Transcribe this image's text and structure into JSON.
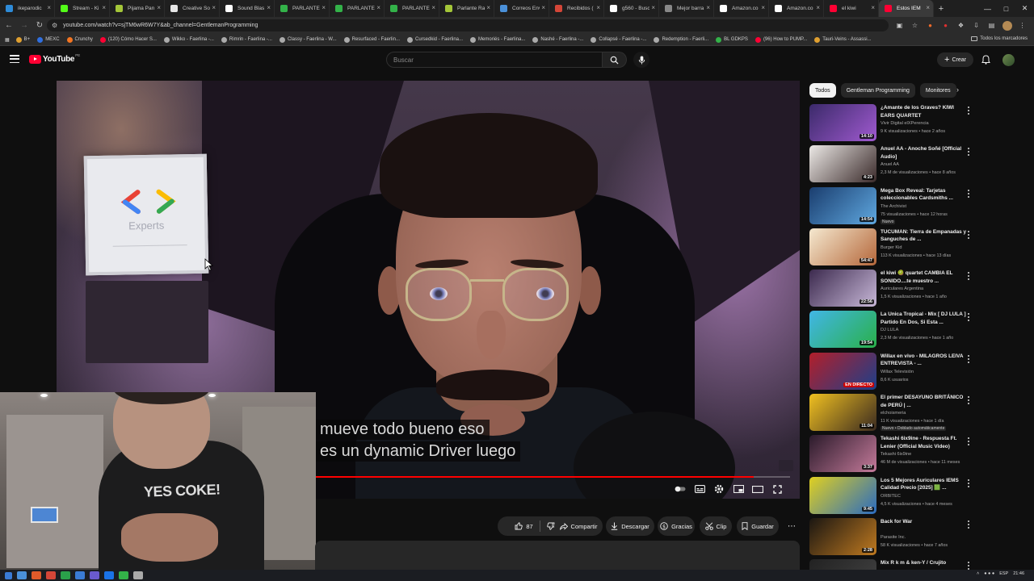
{
  "browser": {
    "tabs": [
      {
        "title": "ikeparodic",
        "favicon_color": "#2e8bd8"
      },
      {
        "title": "Stream - Ki",
        "favicon_color": "#53fc18"
      },
      {
        "title": "Pijama Pan",
        "favicon_color": "#a4c639"
      },
      {
        "title": "Creative So",
        "favicon_color": "#e6e6e6"
      },
      {
        "title": "Sound Blas",
        "favicon_color": "#ffffff"
      },
      {
        "title": "PARLANTE",
        "favicon_color": "#33b249"
      },
      {
        "title": "PARLANTE",
        "favicon_color": "#33b249"
      },
      {
        "title": "PARLANTE",
        "favicon_color": "#33b249"
      },
      {
        "title": "Parlante Ra",
        "favicon_color": "#a4c639"
      },
      {
        "title": "Correos Env",
        "favicon_color": "#4a90d9"
      },
      {
        "title": "Recibidos (",
        "favicon_color": "#d44638"
      },
      {
        "title": "g560 - Busc",
        "favicon_color": "#ffffff"
      },
      {
        "title": "Mejor barra",
        "favicon_color": "#888888"
      },
      {
        "title": "Amazon.co",
        "favicon_color": "#ffffff"
      },
      {
        "title": "Amazon.co",
        "favicon_color": "#ffffff"
      },
      {
        "title": "el kiwi",
        "favicon_color": "#ff0033"
      },
      {
        "title": "Estos IEM",
        "favicon_color": "#ff0033",
        "active": true
      }
    ],
    "url": "youtube.com/watch?v=sjTM6wR6W7Y&ab_channel=GentlemanProgramming",
    "bookmarks": [
      {
        "label": "B+",
        "color": "#e0a030"
      },
      {
        "label": "MEXC",
        "color": "#2f6fe0"
      },
      {
        "label": "Crunchy",
        "color": "#f47521"
      },
      {
        "label": "(120) Cómo Hacer S...",
        "color": "#ff0033"
      },
      {
        "label": "Wikko - Faerlina -...",
        "color": "#aaaaaa"
      },
      {
        "label": "Rimrin - Faerlina -...",
        "color": "#aaaaaa"
      },
      {
        "label": "Classy - Faerlina - W...",
        "color": "#aaaaaa"
      },
      {
        "label": "Resurfaced - Faerlin...",
        "color": "#aaaaaa"
      },
      {
        "label": "Cursedkid - Faerlina...",
        "color": "#aaaaaa"
      },
      {
        "label": "Memoriés - Faerlina...",
        "color": "#aaaaaa"
      },
      {
        "label": "Nashé - Faerlina -...",
        "color": "#aaaaaa"
      },
      {
        "label": "Collapsé - Faerlina -...",
        "color": "#aaaaaa"
      },
      {
        "label": "Redemption - Faerli...",
        "color": "#aaaaaa"
      },
      {
        "label": "BL GDKPS",
        "color": "#33b249"
      },
      {
        "label": "(96) How to PUMP...",
        "color": "#ff0033"
      },
      {
        "label": "Tauri-Veins - Assassi...",
        "color": "#e0a030"
      }
    ],
    "all_bookmarks": "Todos los marcadores"
  },
  "youtube": {
    "logo_text": "YouTube",
    "logo_region": "PE",
    "search_placeholder": "Buscar",
    "create_label": "Crear"
  },
  "player": {
    "caption_lines": [
      "mueve todo bueno eso",
      "es un dynamic Driver luego"
    ],
    "progress_fraction": 0.95,
    "sign_text": "Experts",
    "webcam_shirt_text": "YES COKE!"
  },
  "actions": {
    "like_count": "87",
    "share": "Compartir",
    "download": "Descargar",
    "thanks": "Gracias",
    "clip": "Clip",
    "save": "Guardar"
  },
  "chips": [
    "Todos",
    "Gentleman Programming",
    "Monitores"
  ],
  "recommendations": [
    {
      "title": "¿Amante de los Graves? KIWI EARS QUARTET",
      "channel": "Vivir Digital elXPerencia",
      "meta": "9 K visualizaciones • hace 2 años",
      "duration": "14:10",
      "thumb": [
        "#3b2a6a",
        "#a05ad0"
      ],
      "badge": ""
    },
    {
      "title": "Anuel AA - Anoche Soñé [Official Audio]",
      "channel": "Anuel AA",
      "meta": "2,3 M de visualizaciones • hace 8 años",
      "duration": "4:23",
      "thumb": [
        "#ece9e6",
        "#3a2a2a"
      ],
      "badge": ""
    },
    {
      "title": "Mega Box Reveal: Tarjetas coleccionables Cardsmiths ...",
      "channel": "The Archivist",
      "meta": "75 visualizaciones • hace 12 horas",
      "duration": "14:54",
      "thumb": [
        "#1a3d6e",
        "#5fa8e0"
      ],
      "badge": "Nuevo"
    },
    {
      "title": "TUCUMAN: Tierra de Empanadas y Sanguches de ...",
      "channel": "Burger Kid",
      "meta": "113 K visualizaciones • hace 13 días",
      "duration": "54:47",
      "thumb": [
        "#f5e9d0",
        "#b5673a"
      ],
      "badge": ""
    },
    {
      "title": "el kiwi 🥝 quartet CAMBIA EL SONIDO....te muestro ...",
      "channel": "Auriculares Argentina",
      "meta": "1,5 K visualizaciones • hace 1 año",
      "duration": "22:56",
      "thumb": [
        "#3c2a4e",
        "#c8b8d8"
      ],
      "badge": ""
    },
    {
      "title": "La Unica Tropical - Mix [ DJ LULA ] Partido En Dos, Si Esta ...",
      "channel": "DJ LULA",
      "meta": "2,3 M de visualizaciones • hace 1 año",
      "duration": "19:54",
      "thumb": [
        "#41b6e6",
        "#2ab04a"
      ],
      "badge": ""
    },
    {
      "title": "Willax en vivo - MILAGROS LEIVA ENTREVISTA - ...",
      "channel": "Willax Televisión",
      "meta": "8,6 K usuarios",
      "duration": "EN DIRECTO",
      "thumb": [
        "#b21f2a",
        "#1d3f8a"
      ],
      "badge": ""
    },
    {
      "title": "El primer DESAYUNO BRITÁNICO de PERÚ | ...",
      "channel": "elchoismeria",
      "meta": "11 K visualizaciones • hace 1 día",
      "duration": "11:04",
      "thumb": [
        "#f0c020",
        "#3a2a20"
      ],
      "badge": "Nuevo • Doblado automáticamente"
    },
    {
      "title": "Tekashi 6ix9ine - Respuesta Ft. Lenier (Official Music Video)",
      "channel": "Tekashi 6ix9ine",
      "meta": "46 M de visualizaciones • hace 11 meses",
      "duration": "3:37",
      "thumb": [
        "#2a1a2a",
        "#c47a9a"
      ],
      "badge": ""
    },
    {
      "title": "Los 5 Mejores Auriculares IEMS Calidad Precio [2025] 🟩 ...",
      "channel": "ORBITEC",
      "meta": "4,5 K visualizaciones • hace 4 meses",
      "duration": "9:45",
      "thumb": [
        "#e0d020",
        "#2a6bc0"
      ],
      "badge": ""
    },
    {
      "title": "Back for War",
      "channel": "Parasite Inc.",
      "meta": "58 K visualizaciones • hace 7 años",
      "duration": "2:28",
      "thumb": [
        "#1a1612",
        "#c07a20"
      ],
      "badge": ""
    },
    {
      "title": "Mix R k m & ken-Y / Crujito",
      "channel": "",
      "meta": "",
      "duration": "",
      "thumb": [
        "#222222",
        "#444444"
      ],
      "badge": ""
    }
  ],
  "taskbar": {
    "icons": [
      "#4a90d9",
      "#e05a2a",
      "#d44638",
      "#2aa04a",
      "#3a7bd5",
      "#6a5acd",
      "#1a73e8",
      "#33b249",
      "#aaaaaa"
    ],
    "lang": "ESP",
    "time": "21:46"
  }
}
